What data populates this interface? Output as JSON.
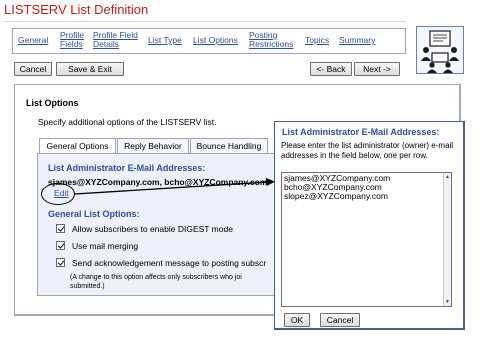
{
  "page": {
    "title": "LISTSERV List Definition"
  },
  "nav": {
    "items": [
      {
        "line1": "General",
        "line2": ""
      },
      {
        "line1": "Profile",
        "line2": "Fields"
      },
      {
        "line1": "Profile Field",
        "line2": "Details"
      },
      {
        "line1": "List Type",
        "line2": ""
      },
      {
        "line1": "List Options",
        "line2": ""
      },
      {
        "line1": "Posting",
        "line2": "Restrictions"
      },
      {
        "line1": "Topics",
        "line2": ""
      },
      {
        "line1": "Summary",
        "line2": ""
      }
    ],
    "active": "List Options"
  },
  "logo": {
    "icon": "people-meeting-icon"
  },
  "toolbar": {
    "cancel": "Cancel",
    "save_exit": "Save & Exit",
    "back": "<- Back",
    "next": "Next ->"
  },
  "panel": {
    "title": "List Options",
    "description": "Specify additional options of the LISTSERV list.",
    "tabs": [
      "General Options",
      "Reply Behavior",
      "Bounce Handling"
    ],
    "active_tab": "General Options",
    "admin_heading": "List Administrator E-Mail Addresses:",
    "admin_emails": "sjames@XYZCompany.com, bcho@XYZCompany.com",
    "edit_link": "Edit",
    "general_heading": "General List Options:",
    "options": [
      {
        "label": "Allow subscribers to enable DIGEST mode",
        "checked": true
      },
      {
        "label": "Use mail merging",
        "checked": true
      },
      {
        "label": "Send acknowledgement message to posting subscr",
        "checked": true
      }
    ],
    "note_line1": "(A change to this option affects only subscribers who joi",
    "note_line2": "submitted.)"
  },
  "dialog": {
    "title": "List Administrator E-Mail Addresses:",
    "description": "Please enter the list administrator (owner) e-mail addresses in the field below, one per row.",
    "emails": [
      "sjames@XYZCompany.com",
      "bcho@XYZCompany.com",
      "slopez@XYZCompany.com"
    ],
    "ok": "OK",
    "cancel": "Cancel"
  },
  "colors": {
    "title": "#c0201a",
    "link": "#2f4fa3",
    "tab_body": "#eef0fb"
  }
}
